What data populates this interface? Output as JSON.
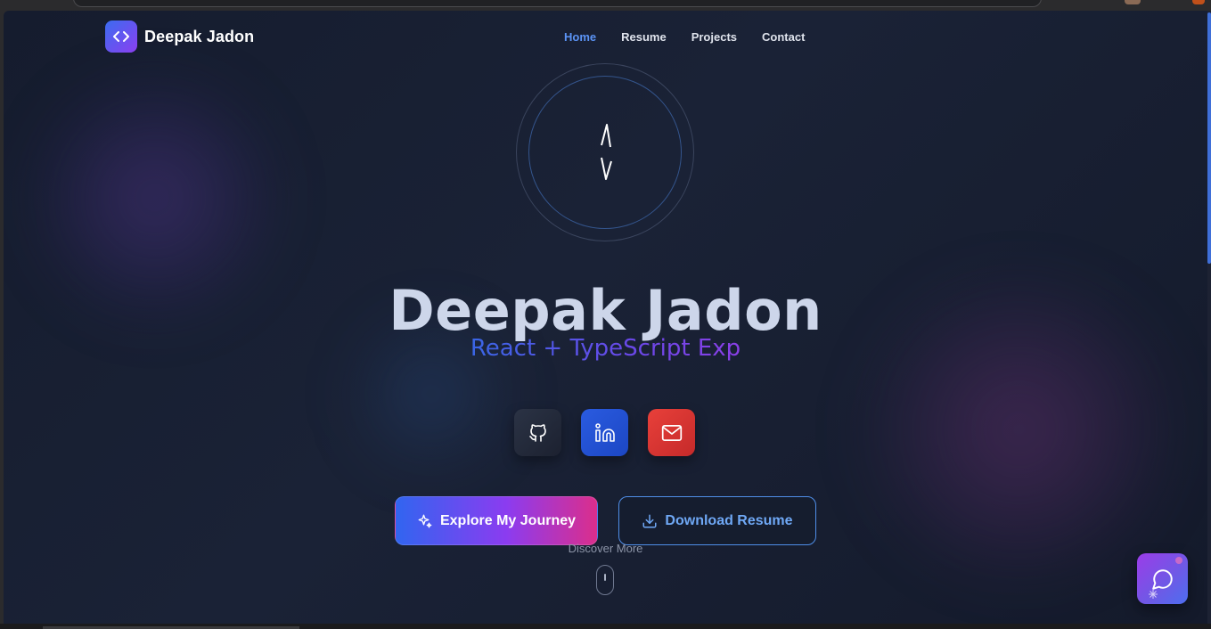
{
  "nav": {
    "brand": "Deepak Jadon",
    "links": [
      {
        "label": "Home",
        "active": true
      },
      {
        "label": "Resume",
        "active": false
      },
      {
        "label": "Projects",
        "active": false
      },
      {
        "label": "Contact",
        "active": false
      }
    ]
  },
  "hero": {
    "name": "Deepak Jadon",
    "subtitle": "React + TypeScript Exp"
  },
  "socials": [
    {
      "name": "GitHub",
      "icon": "github-icon",
      "color": "#2b3345"
    },
    {
      "name": "LinkedIn",
      "icon": "linkedin-icon",
      "color": "#2a5be0"
    },
    {
      "name": "Email",
      "icon": "mail-icon",
      "color": "#e8403a"
    }
  ],
  "actions": {
    "explore_label": "Explore My Journey",
    "download_label": "Download Resume"
  },
  "scroll_hint": "Discover More",
  "colors": {
    "accent_blue": "#5b93f5",
    "gradient_start": "#3165f0",
    "gradient_mid": "#8b3cf0",
    "gradient_end": "#db2e8c"
  }
}
